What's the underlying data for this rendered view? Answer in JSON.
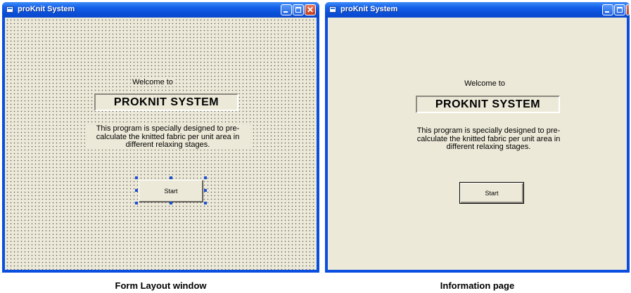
{
  "left_window": {
    "title": "proKnit System",
    "welcome": "Welcome to",
    "system_name": "PROKNIT SYSTEM",
    "description": "This program is specially designed to pre-calculate the knitted fabric per unit area in different relaxing stages.",
    "start_button": "Start",
    "caption": "Form Layout window"
  },
  "right_window": {
    "title": "proKnit System",
    "welcome": "Welcome to",
    "system_name": "PROKNIT SYSTEM",
    "description": "This program is specially designed to pre-calculate the knitted fabric per unit area in different relaxing stages.",
    "start_button": "Start",
    "caption": "Information page"
  },
  "icons": {
    "app": "app-icon",
    "minimize": "minimize-icon",
    "maximize": "maximize-icon",
    "close": "close-icon"
  },
  "colors": {
    "titlebar": "#0a4ee0",
    "client_bg": "#ece9d8",
    "selection_handle": "#1f4fd1",
    "close_button": "#c23d1c"
  }
}
